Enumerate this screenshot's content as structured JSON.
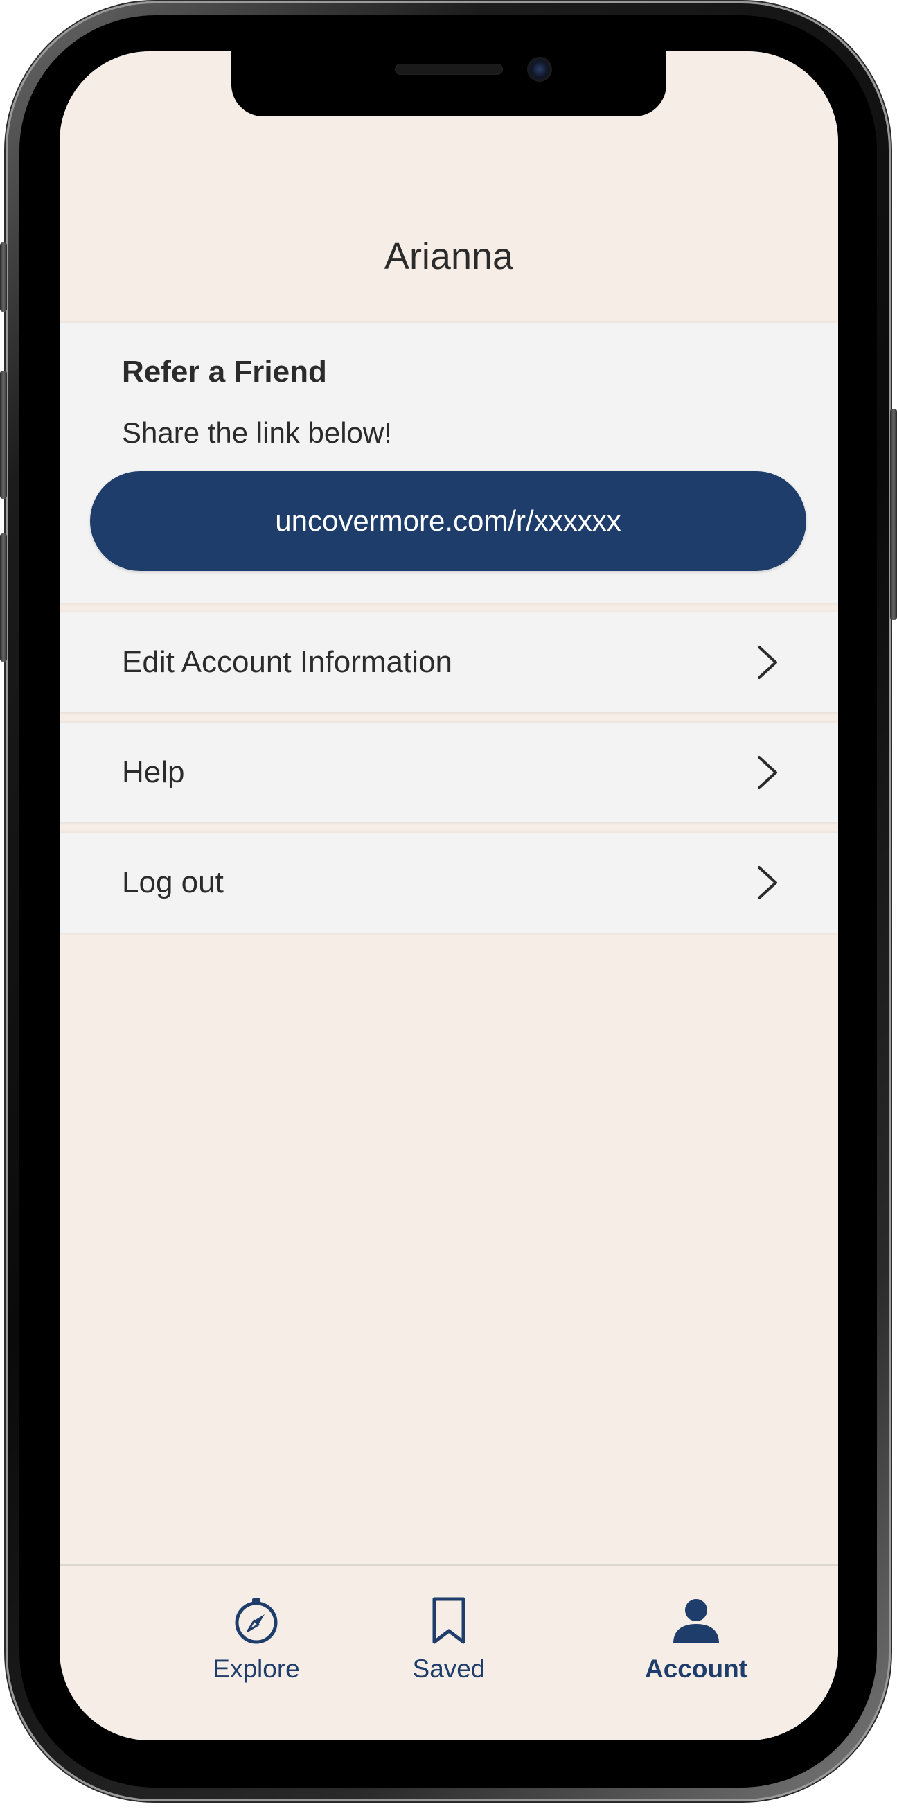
{
  "header": {
    "user_name": "Arianna"
  },
  "refer_friend": {
    "title": "Refer a Friend",
    "subtitle": "Share the link below!",
    "link": "uncovermore.com/r/xxxxxx"
  },
  "menu": {
    "items": [
      {
        "label": "Edit Account Information",
        "icon": "chevron-right-icon"
      },
      {
        "label": "Help",
        "icon": "chevron-right-icon"
      },
      {
        "label": "Log out",
        "icon": "chevron-right-icon"
      }
    ]
  },
  "bottom_nav": {
    "items": [
      {
        "label": "Explore",
        "icon": "compass-icon",
        "active": false
      },
      {
        "label": "Saved",
        "icon": "bookmark-icon",
        "active": false
      },
      {
        "label": "Account",
        "icon": "person-icon",
        "active": true
      }
    ]
  },
  "colors": {
    "background": "#f5ede6",
    "card": "#f3f3f3",
    "accent": "#1e3d6b",
    "text": "#2b2b2b"
  }
}
